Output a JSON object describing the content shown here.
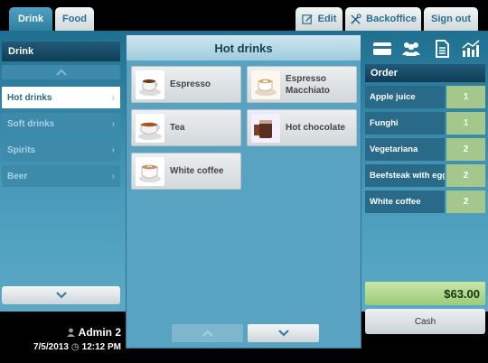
{
  "top_tabs": [
    {
      "label": "Drink",
      "active": true
    },
    {
      "label": "Food",
      "active": false
    }
  ],
  "top_actions": {
    "edit": "Edit",
    "backoffice": "Backoffice",
    "sign_out": "Sign out"
  },
  "categories": {
    "title": "Drink",
    "items": [
      {
        "label": "Hot drinks",
        "selected": true
      },
      {
        "label": "Soft drinks",
        "selected": false
      },
      {
        "label": "Spirits",
        "selected": false
      },
      {
        "label": "Beer",
        "selected": false
      }
    ]
  },
  "user": {
    "name": "Admin 2",
    "date": "7/5/2013",
    "time": "12:12 PM"
  },
  "products": {
    "title": "Hot drinks",
    "items": [
      {
        "label": "Espresso",
        "icon": "espresso-cup-icon"
      },
      {
        "label": "Espresso\nMacchiato",
        "icon": "macchiato-cup-icon"
      },
      {
        "label": "Tea",
        "icon": "tea-cup-icon"
      },
      {
        "label": "Hot chocolate",
        "icon": "hot-chocolate-icon"
      },
      {
        "label": "White coffee",
        "icon": "white-coffee-icon"
      }
    ]
  },
  "order": {
    "title": "Order",
    "lines": [
      {
        "name": "Apple juice",
        "qty": "1"
      },
      {
        "name": "Funghi",
        "qty": "1"
      },
      {
        "name": "Vegetariana",
        "qty": "2"
      },
      {
        "name": "Beefsteak with egg",
        "qty": "2"
      },
      {
        "name": "White coffee",
        "qty": "2"
      }
    ],
    "total": "$63.00",
    "pay_label": "Cash"
  },
  "icons": [
    "card-icon",
    "customers-icon",
    "document-icon",
    "statistics-icon"
  ],
  "colors": {
    "accent": "#2e7e9f",
    "panel": "#58a3c2",
    "qty_green": "#a4c88b",
    "total_green": "#9ccc7a"
  }
}
